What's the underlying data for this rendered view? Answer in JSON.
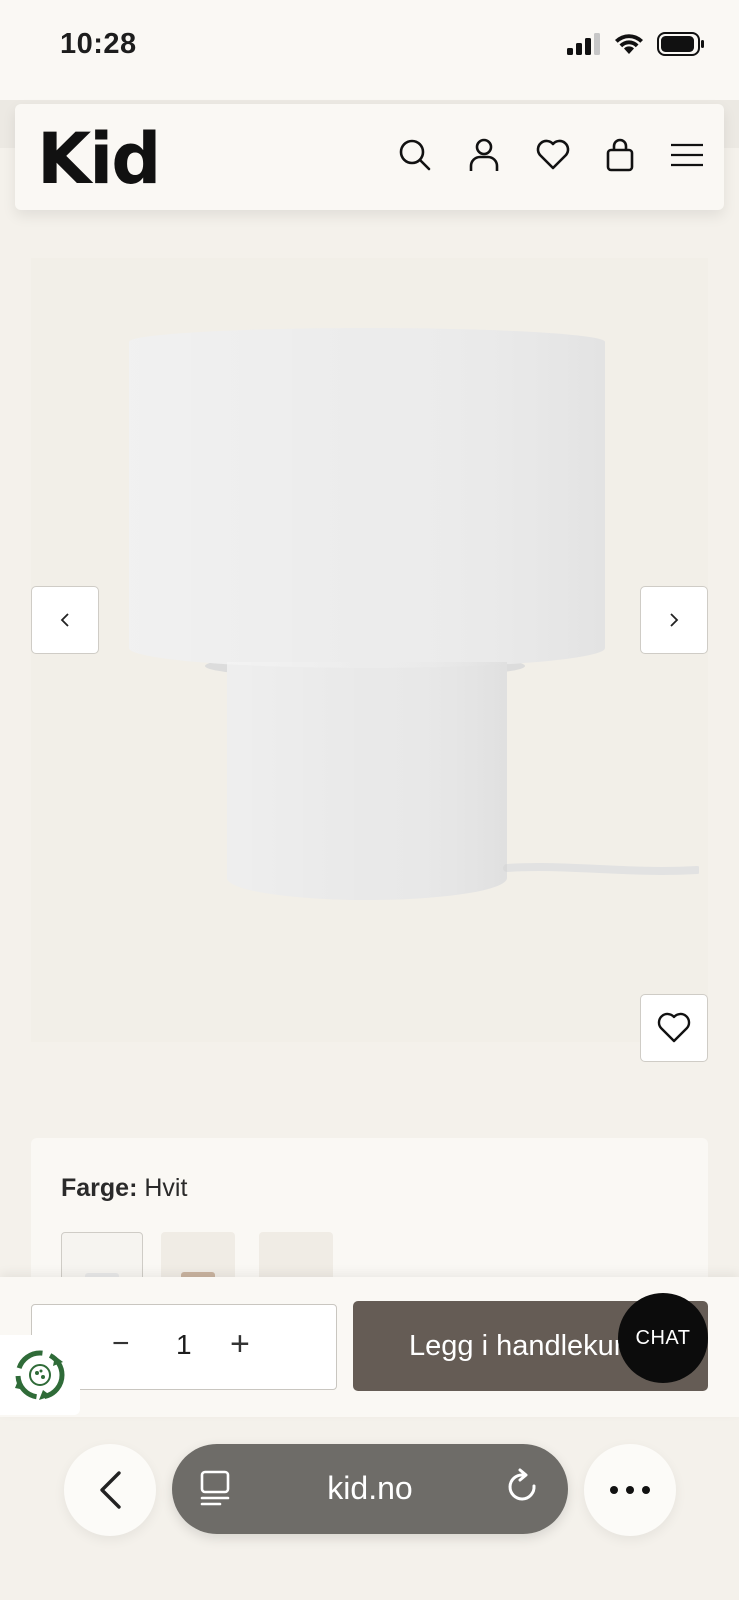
{
  "status_bar": {
    "time": "10:28"
  },
  "header": {
    "logo": "Kid"
  },
  "product": {
    "image_alt": "lamp"
  },
  "color": {
    "label": "Farge:",
    "value": "Hvit"
  },
  "cart": {
    "quantity": "1",
    "minus": "−",
    "plus": "+",
    "add_label": "Legg i handlekurv"
  },
  "chat": {
    "label": "CHAT"
  },
  "browser": {
    "url": "kid.no"
  },
  "colors": {
    "accent": "#655c55",
    "background": "#f4f1eb",
    "chat": "#0c0c0c"
  }
}
